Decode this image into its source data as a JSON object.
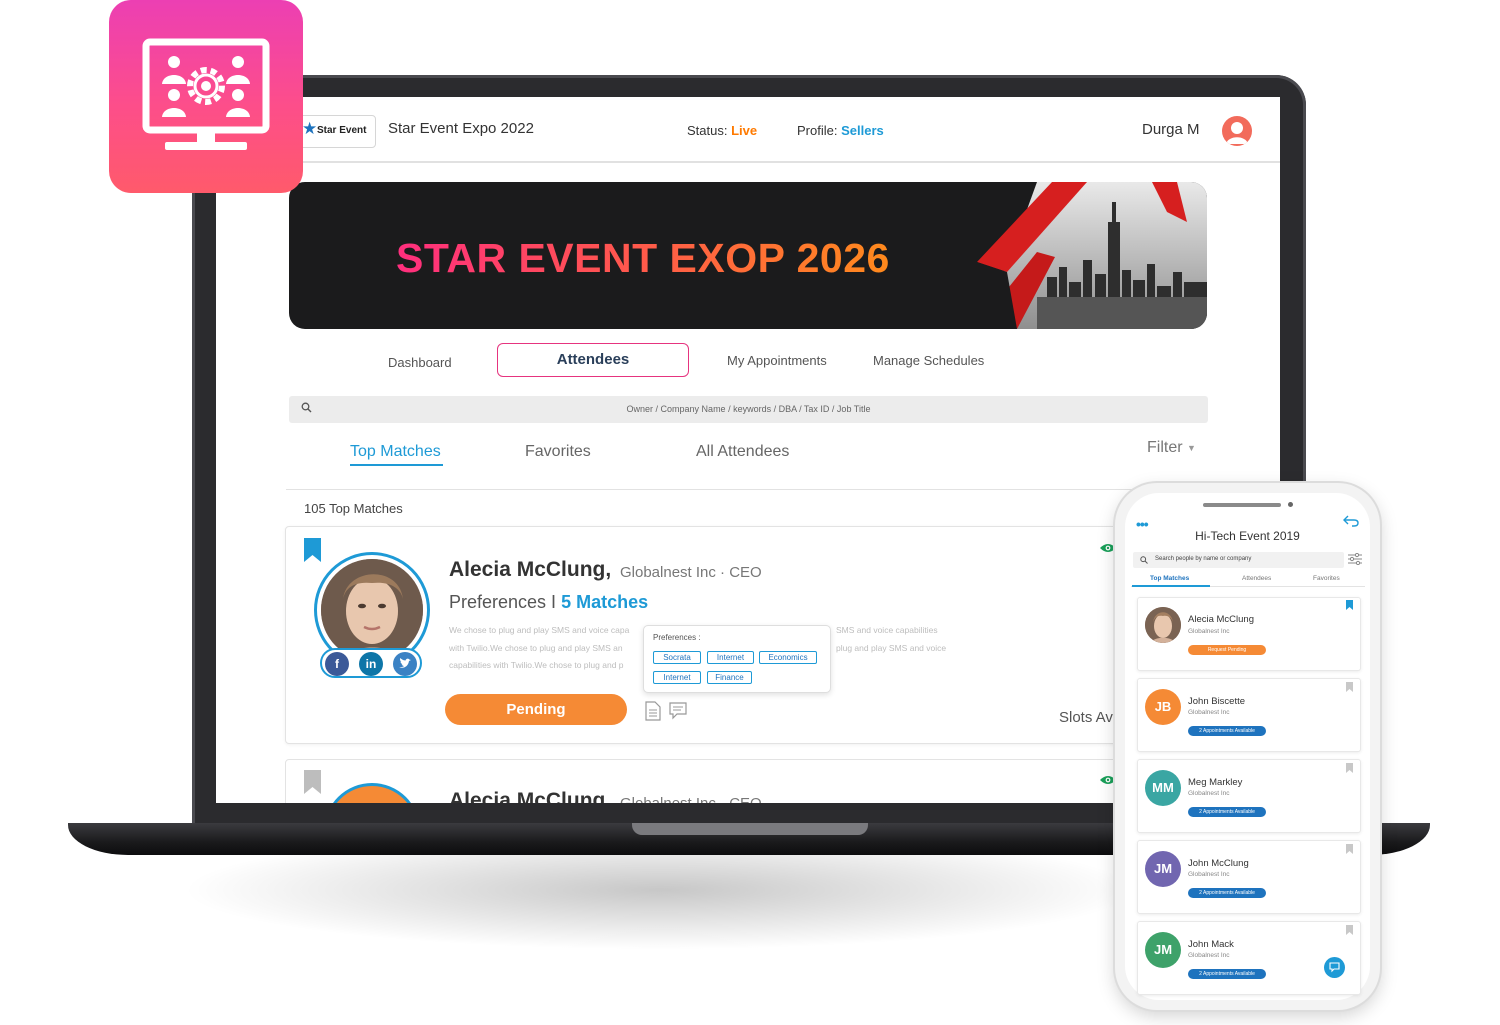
{
  "app_badge": {
    "icon": "monitor-people-gear-icon",
    "gradient": [
      "#ec3fb3",
      "#ff5a6b"
    ]
  },
  "desktop": {
    "header": {
      "logo_text": "Star Event",
      "event_title": "Star Event Expo 2022",
      "status_label": "Status:",
      "status_value": "Live",
      "profile_label": "Profile:",
      "profile_value": "Sellers",
      "user_name": "Durga M"
    },
    "banner": {
      "title": "STAR EVENT EXOP 2026"
    },
    "nav": {
      "dashboard": "Dashboard",
      "attendees": "Attendees",
      "appointments": "My Appointments",
      "schedules": "Manage Schedules"
    },
    "search": {
      "placeholder": "Owner / Company Name / keywords / DBA / Tax ID / Job Title"
    },
    "tabs": {
      "top_matches": "Top Matches",
      "favorites": "Favorites",
      "all_attendees": "All Attendees",
      "filter": "Filter"
    },
    "count_text": "105  Top Matches",
    "card": {
      "name": "Alecia McClung,",
      "company": "Globalnest Inc  · CEO",
      "pref_label": "Preferences I",
      "matches": "5 Matches",
      "desc_lines": [
        "We chose to plug and play SMS and voice capa",
        "with  Twilio.We chose to plug and play SMS an",
        "capabilities with  Twilio.We chose to plug and p"
      ],
      "desc_right": [
        "SMS and voice capabilities",
        "plug and play SMS and voice"
      ],
      "popup_title": "Preferences :",
      "chips": [
        "Socrata",
        "Internet",
        "Economics",
        "Internet",
        "Finance"
      ],
      "button": "Pending",
      "slots": "Slots Av"
    },
    "card2": {
      "name": "Alecia McClung,",
      "company": "Globalnest Inc  · CEO"
    }
  },
  "phone": {
    "title": "Hi-Tech Event 2019",
    "search_placeholder": "Search people by name or company",
    "tabs": [
      "Top Matches",
      "Attendees",
      "Favorites"
    ],
    "people": [
      {
        "initials": "",
        "name": "Alecia McClung",
        "company": "Globalnest Inc",
        "badge": "Request Pending",
        "color": "#f58a35"
      },
      {
        "initials": "JB",
        "name": "John Biscette",
        "company": "Globalnest Inc",
        "badge": "2 Appointments Available",
        "color": "#f58a35"
      },
      {
        "initials": "MM",
        "name": "Meg Markley",
        "company": "Globalnest Inc",
        "badge": "2 Appointments Available",
        "color": "#3aa6a3"
      },
      {
        "initials": "JM",
        "name": "John McClung",
        "company": "Globalnest Inc",
        "badge": "2 Appointments Available",
        "color": "#7166b0"
      },
      {
        "initials": "JM",
        "name": "John Mack",
        "company": "Globalnest Inc",
        "badge": "2 Appointments Available",
        "color": "#3ea26a"
      }
    ]
  },
  "colors": {
    "accent": "#1e9ad6",
    "pink": "#e6347f",
    "orange": "#f58a35",
    "live": "#ff7a00"
  }
}
